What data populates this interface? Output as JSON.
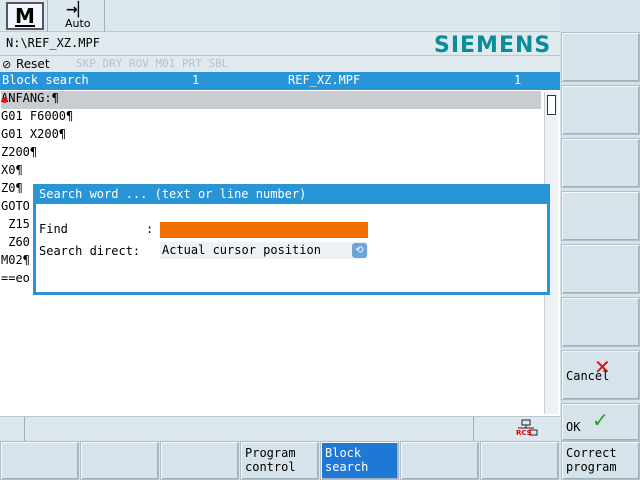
{
  "header": {
    "mode_letter": "M",
    "mode_sub": "Auto",
    "path": "N:\\REF_XZ.MPF",
    "brand": "SIEMENS",
    "reset_label": "Reset",
    "program_flags": "SKP DRY ROV M01 PRT SBL"
  },
  "blockbar": {
    "title": "Block search",
    "channel": "1",
    "file": "REF_XZ.MPF",
    "count": "1"
  },
  "editor": {
    "lines": [
      "ANFANG:¶",
      "G01 F6000¶",
      "G01 X200¶",
      "Z200¶",
      "X0¶",
      "Z0¶",
      "GOTO",
      " Z15",
      " Z60",
      "M02¶",
      "==eo"
    ]
  },
  "dialog": {
    "title": "Search word ... (text or line number)",
    "find_label": "Find",
    "find_colon": ":",
    "find_value": "",
    "direction_label": "Search direct:",
    "direction_value": "Actual cursor position"
  },
  "status": {
    "rcs": "RCS"
  },
  "vertical_softkeys": [
    "",
    "",
    "",
    "",
    "",
    "",
    "",
    "Cancel",
    "OK"
  ],
  "horizontal_softkeys": [
    "",
    "",
    "",
    "Program\ncontrol",
    "Block\nsearch",
    "",
    "",
    "Correct\nprogram"
  ],
  "colors": {
    "accent": "#2a95d6",
    "input": "#f07000",
    "brand": "#0b8c9a",
    "cancel": "#e01010",
    "ok": "#22a022"
  }
}
